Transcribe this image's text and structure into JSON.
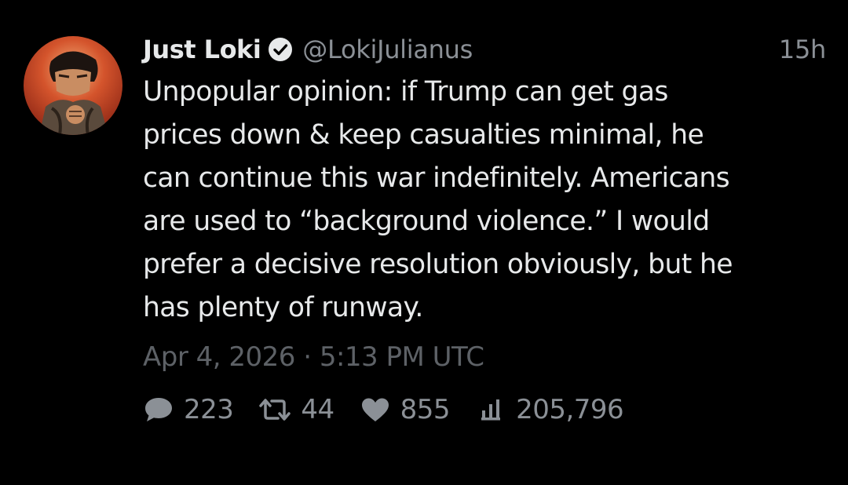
{
  "author": {
    "display_name": "Just Loki",
    "handle": "@LokiJulianus",
    "verified": true,
    "avatar_icon": "anime-character-avatar"
  },
  "time_ago": "15h",
  "text_lines": [
    "Unpopular opinion: if Trump can get gas",
    "prices down & keep casualties minimal, he",
    "can continue this war indefinitely. Americans",
    "are used to “background violence.” I would",
    "prefer a decisive resolution obviously, but he",
    "has plenty of runway."
  ],
  "timestamp": "Apr 4, 2026 · 5:13 PM UTC",
  "stats": {
    "replies": "223",
    "reposts": "44",
    "likes": "855",
    "views": "205,796"
  },
  "icons": {
    "reply": "speech-bubble-icon",
    "repost": "retweet-arrows-icon",
    "like": "heart-icon",
    "views": "bar-chart-icon",
    "verified": "verified-check-icon"
  }
}
